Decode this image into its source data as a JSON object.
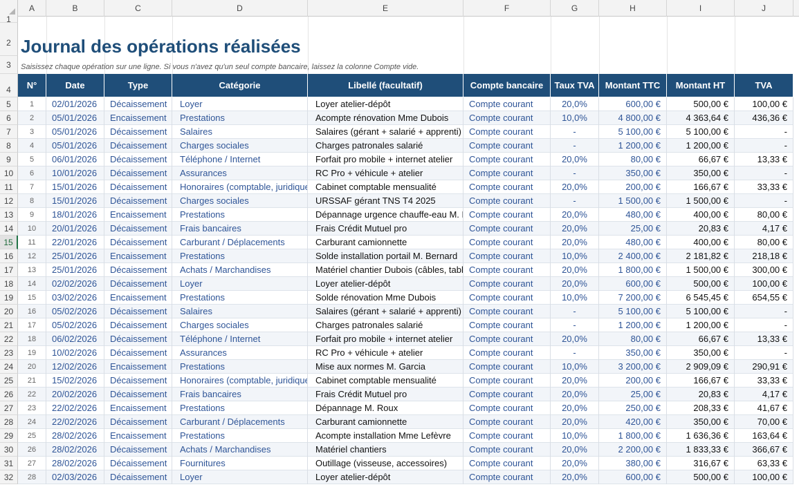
{
  "sheet": {
    "title": "Journal des opérations réalisées",
    "subtitle": "Saisissez chaque opération sur une ligne. Si vous n'avez qu'un seul compte bancaire, laissez la colonne Compte vide.",
    "column_letters": [
      "A",
      "B",
      "C",
      "D",
      "E",
      "F",
      "G",
      "H",
      "I",
      "J"
    ],
    "row_numbers": [
      "1",
      "2",
      "3",
      "4",
      "5",
      "6",
      "7",
      "8",
      "9",
      "10",
      "11",
      "12",
      "13",
      "14",
      "15",
      "16",
      "17",
      "18",
      "19",
      "20",
      "21",
      "22",
      "23",
      "24",
      "25",
      "26",
      "27",
      "28",
      "29",
      "30",
      "31",
      "32"
    ],
    "selected_row": "15",
    "headers": [
      "N°",
      "Date",
      "Type",
      "Catégorie",
      "Libellé (facultatif)",
      "Compte bancaire",
      "Taux TVA",
      "Montant TTC",
      "Montant HT",
      "TVA"
    ],
    "rows": [
      [
        "1",
        "02/01/2026",
        "Décaissement",
        "Loyer",
        "Loyer atelier-dépôt",
        "Compte courant",
        "20,0%",
        "600,00 €",
        "500,00 €",
        "100,00 €"
      ],
      [
        "2",
        "05/01/2026",
        "Encaissement",
        "Prestations",
        "Acompte rénovation Mme Dubois",
        "Compte courant",
        "10,0%",
        "4 800,00 €",
        "4 363,64 €",
        "436,36 €"
      ],
      [
        "3",
        "05/01/2026",
        "Décaissement",
        "Salaires",
        "Salaires (gérant + salarié + apprenti)",
        "Compte courant",
        "-",
        "5 100,00 €",
        "5 100,00 €",
        "-"
      ],
      [
        "4",
        "05/01/2026",
        "Décaissement",
        "Charges sociales",
        "Charges patronales salarié",
        "Compte courant",
        "-",
        "1 200,00 €",
        "1 200,00 €",
        "-"
      ],
      [
        "5",
        "06/01/2026",
        "Décaissement",
        "Téléphone / Internet",
        "Forfait pro mobile + internet atelier",
        "Compte courant",
        "20,0%",
        "80,00 €",
        "66,67 €",
        "13,33 €"
      ],
      [
        "6",
        "10/01/2026",
        "Décaissement",
        "Assurances",
        "RC Pro + véhicule + atelier",
        "Compte courant",
        "-",
        "350,00 €",
        "350,00 €",
        "-"
      ],
      [
        "7",
        "15/01/2026",
        "Décaissement",
        "Honoraires (comptable, juridique)",
        "Cabinet comptable mensualité",
        "Compte courant",
        "20,0%",
        "200,00 €",
        "166,67 €",
        "33,33 €"
      ],
      [
        "8",
        "15/01/2026",
        "Décaissement",
        "Charges sociales",
        "URSSAF gérant TNS T4 2025",
        "Compte courant",
        "-",
        "1 500,00 €",
        "1 500,00 €",
        "-"
      ],
      [
        "9",
        "18/01/2026",
        "Encaissement",
        "Prestations",
        "Dépannage urgence chauffe-eau M. Martin",
        "Compte courant",
        "20,0%",
        "480,00 €",
        "400,00 €",
        "80,00 €"
      ],
      [
        "10",
        "20/01/2026",
        "Décaissement",
        "Frais bancaires",
        "Frais Crédit Mutuel pro",
        "Compte courant",
        "20,0%",
        "25,00 €",
        "20,83 €",
        "4,17 €"
      ],
      [
        "11",
        "22/01/2026",
        "Décaissement",
        "Carburant / Déplacements",
        "Carburant camionnette",
        "Compte courant",
        "20,0%",
        "480,00 €",
        "400,00 €",
        "80,00 €"
      ],
      [
        "12",
        "25/01/2026",
        "Encaissement",
        "Prestations",
        "Solde installation portail M. Bernard",
        "Compte courant",
        "10,0%",
        "2 400,00 €",
        "2 181,82 €",
        "218,18 €"
      ],
      [
        "13",
        "25/01/2026",
        "Décaissement",
        "Achats / Marchandises",
        "Matériel chantier Dubois (câbles, tableau)",
        "Compte courant",
        "20,0%",
        "1 800,00 €",
        "1 500,00 €",
        "300,00 €"
      ],
      [
        "14",
        "02/02/2026",
        "Décaissement",
        "Loyer",
        "Loyer atelier-dépôt",
        "Compte courant",
        "20,0%",
        "600,00 €",
        "500,00 €",
        "100,00 €"
      ],
      [
        "15",
        "03/02/2026",
        "Encaissement",
        "Prestations",
        "Solde rénovation Mme Dubois",
        "Compte courant",
        "10,0%",
        "7 200,00 €",
        "6 545,45 €",
        "654,55 €"
      ],
      [
        "16",
        "05/02/2026",
        "Décaissement",
        "Salaires",
        "Salaires (gérant + salarié + apprenti)",
        "Compte courant",
        "-",
        "5 100,00 €",
        "5 100,00 €",
        "-"
      ],
      [
        "17",
        "05/02/2026",
        "Décaissement",
        "Charges sociales",
        "Charges patronales salarié",
        "Compte courant",
        "-",
        "1 200,00 €",
        "1 200,00 €",
        "-"
      ],
      [
        "18",
        "06/02/2026",
        "Décaissement",
        "Téléphone / Internet",
        "Forfait pro mobile + internet atelier",
        "Compte courant",
        "20,0%",
        "80,00 €",
        "66,67 €",
        "13,33 €"
      ],
      [
        "19",
        "10/02/2026",
        "Décaissement",
        "Assurances",
        "RC Pro + véhicule + atelier",
        "Compte courant",
        "-",
        "350,00 €",
        "350,00 €",
        "-"
      ],
      [
        "20",
        "12/02/2026",
        "Encaissement",
        "Prestations",
        "Mise aux normes M. Garcia",
        "Compte courant",
        "10,0%",
        "3 200,00 €",
        "2 909,09 €",
        "290,91 €"
      ],
      [
        "21",
        "15/02/2026",
        "Décaissement",
        "Honoraires (comptable, juridique)",
        "Cabinet comptable mensualité",
        "Compte courant",
        "20,0%",
        "200,00 €",
        "166,67 €",
        "33,33 €"
      ],
      [
        "22",
        "20/02/2026",
        "Décaissement",
        "Frais bancaires",
        "Frais Crédit Mutuel pro",
        "Compte courant",
        "20,0%",
        "25,00 €",
        "20,83 €",
        "4,17 €"
      ],
      [
        "23",
        "22/02/2026",
        "Encaissement",
        "Prestations",
        "Dépannage M. Roux",
        "Compte courant",
        "20,0%",
        "250,00 €",
        "208,33 €",
        "41,67 €"
      ],
      [
        "24",
        "22/02/2026",
        "Décaissement",
        "Carburant / Déplacements",
        "Carburant camionnette",
        "Compte courant",
        "20,0%",
        "420,00 €",
        "350,00 €",
        "70,00 €"
      ],
      [
        "25",
        "28/02/2026",
        "Encaissement",
        "Prestations",
        "Acompte installation Mme Lefèvre",
        "Compte courant",
        "10,0%",
        "1 800,00 €",
        "1 636,36 €",
        "163,64 €"
      ],
      [
        "26",
        "28/02/2026",
        "Décaissement",
        "Achats / Marchandises",
        "Matériel chantiers",
        "Compte courant",
        "20,0%",
        "2 200,00 €",
        "1 833,33 €",
        "366,67 €"
      ],
      [
        "27",
        "28/02/2026",
        "Décaissement",
        "Fournitures",
        "Outillage (visseuse, accessoires)",
        "Compte courant",
        "20,0%",
        "380,00 €",
        "316,67 €",
        "63,33 €"
      ],
      [
        "28",
        "02/03/2026",
        "Décaissement",
        "Loyer",
        "Loyer atelier-dépôt",
        "Compte courant",
        "20,0%",
        "600,00 €",
        "500,00 €",
        "100,00 €"
      ]
    ],
    "colors": {
      "header_bg": "#1f4e79",
      "title": "#1f4e79",
      "link_blue": "#2f5597",
      "row_alt": "#f2f5f9",
      "selected_row_accent": "#217346"
    }
  }
}
